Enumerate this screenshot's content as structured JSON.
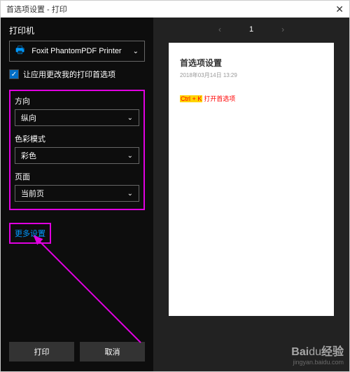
{
  "title": "首选项设置 - 打印",
  "sidebar": {
    "printer_label": "打印机",
    "printer_name": "Foxit PhantomPDF Printer",
    "checkbox_label": "让应用更改我的打印首选项",
    "orientation": {
      "label": "方向",
      "value": "纵向"
    },
    "color": {
      "label": "色彩模式",
      "value": "彩色"
    },
    "page": {
      "label": "页面",
      "value": "当前页"
    },
    "more_link": "更多设置"
  },
  "buttons": {
    "print": "打印",
    "cancel": "取消"
  },
  "preview": {
    "current_page": "1",
    "doc_title": "首选项设置",
    "doc_date": "2018年03月14日 13:29",
    "highlight_key": "Ctrl + K",
    "highlight_text": "打开首选项"
  },
  "watermark": {
    "brand_a": "Bai",
    "brand_b": "du",
    "brand_c": "经验",
    "url": "jingyan.baidu.com"
  }
}
